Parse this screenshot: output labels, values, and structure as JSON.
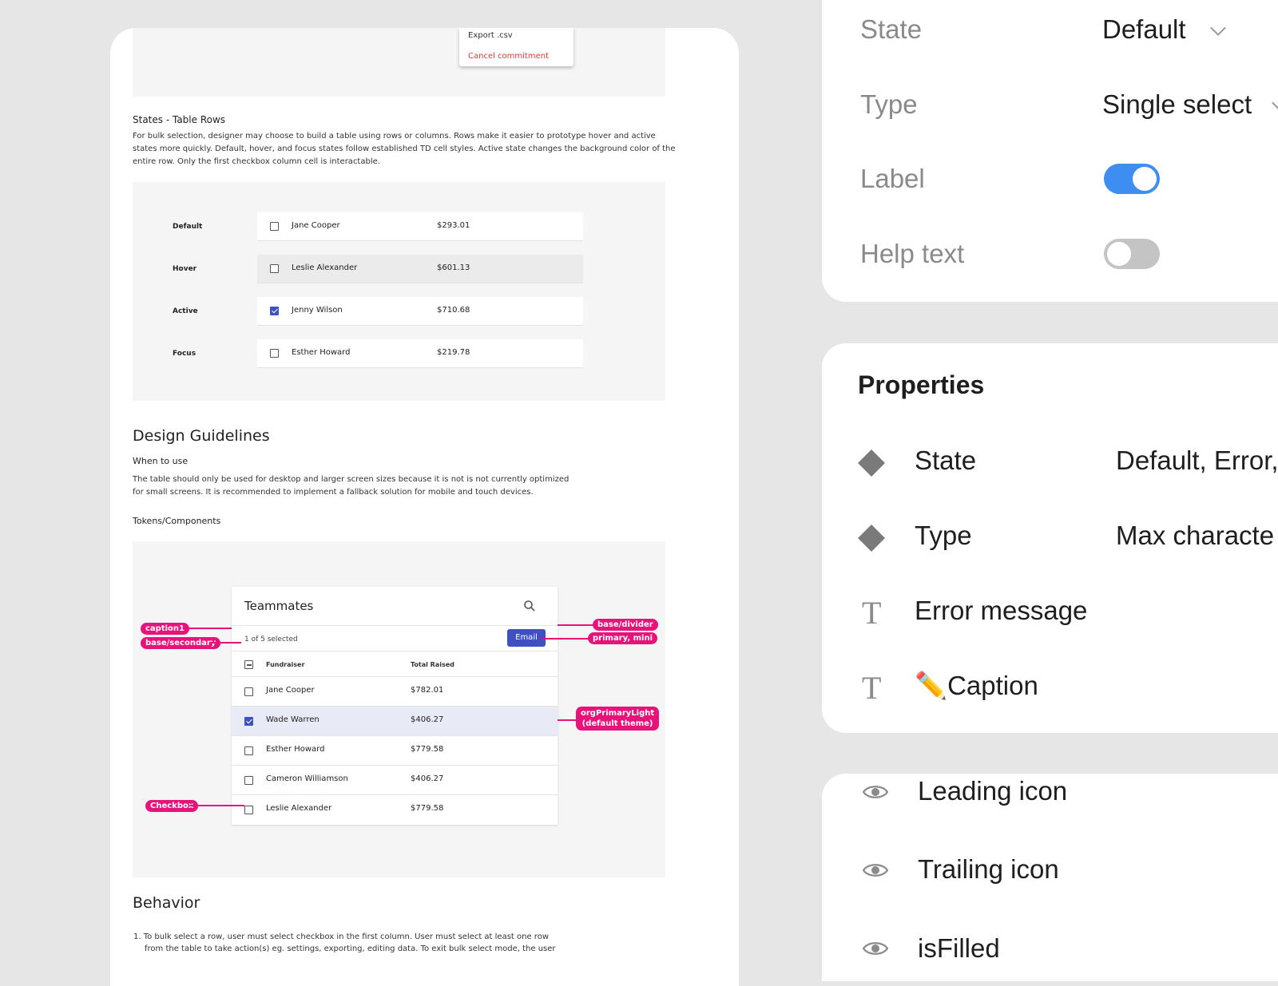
{
  "doc": {
    "menu": {
      "export": "Export .csv",
      "cancel": "Cancel commitment",
      "cancel_color": "#e53935"
    },
    "states_heading": "States - Table Rows",
    "states_desc_1": "For bulk selection, designer may choose to build a table using rows or columns. Rows make it easier to prototype hover and active",
    "states_desc_2": "states more quickly. Default, hover, and focus states follow established TD cell styles. Active state changes the background color of the",
    "states_desc_3": "entire row. Only the first checkbox column cell is interactable.",
    "state_rows": [
      {
        "state": "Default",
        "name": "Jane Cooper",
        "amount": "$293.01",
        "checked": false
      },
      {
        "state": "Hover",
        "name": "Leslie Alexander",
        "amount": "$601.13",
        "checked": false
      },
      {
        "state": "Active",
        "name": "Jenny Wilson",
        "amount": "$710.68",
        "checked": true
      },
      {
        "state": "Focus",
        "name": "Esther Howard",
        "amount": "$219.78",
        "checked": false
      }
    ],
    "guidelines_heading": "Design Guidelines",
    "when_heading": "When to use",
    "when_desc_1": "The table should only be used for desktop and larger screen sizes because it is not is not currently optimized",
    "when_desc_2": "for small screens. It is recommended to implement a fallback solution for mobile and touch devices.",
    "tokens_heading": "Tokens/Components",
    "teammates": {
      "title": "Teammates",
      "selected": "1 of 5 selected",
      "email_button": "Email",
      "col_fundraiser": "Fundraiser",
      "col_total": "Total Raised",
      "rows": [
        {
          "name": "Jane Cooper",
          "amount": "$782.01",
          "checked": false
        },
        {
          "name": "Wade Warren",
          "amount": "$406.27",
          "checked": true
        },
        {
          "name": "Esther Howard",
          "amount": "$779.58",
          "checked": false
        },
        {
          "name": "Cameron Williamson",
          "amount": "$406.27",
          "checked": false
        },
        {
          "name": "Leslie Alexander",
          "amount": "$779.58",
          "checked": false
        }
      ]
    },
    "annotations": {
      "caption1": "caption1",
      "base_secondary": "base/secondary",
      "base_divider": "base/divider",
      "primary_mini": "primary, mini",
      "org_primary_1": "orgPrimaryLight",
      "org_primary_2": "(default theme)",
      "checkbox": "Checkbox"
    },
    "behavior_heading": "Behavior",
    "behavior_1": "1. To bulk select a row, user must select checkbox in the first column. User must select at least one row",
    "behavior_2": "from the table to take action(s) eg. settings, exporting, editing data.  To exit bulk select mode, the user"
  },
  "panel1": {
    "state_label": "State",
    "state_value": "Default",
    "type_label": "Type",
    "type_value": "Single select",
    "label_label": "Label",
    "label_on": true,
    "help_label": "Help text",
    "help_on": false
  },
  "panel2": {
    "title": "Properties",
    "rows": [
      {
        "icon": "diamond-icon",
        "name": "State",
        "value": "Default, Error,"
      },
      {
        "icon": "diamond-icon",
        "name": "Type",
        "value": "Max characte"
      },
      {
        "icon": "text-icon",
        "name": "Error message",
        "value": ""
      },
      {
        "icon": "text-icon",
        "name": "✏️Caption",
        "value": ""
      }
    ]
  },
  "panel3": {
    "rows": [
      {
        "icon": "eye-icon",
        "name": "Leading icon"
      },
      {
        "icon": "eye-icon",
        "name": "Trailing icon"
      },
      {
        "icon": "eye-icon",
        "name": "isFilled"
      }
    ]
  },
  "colors": {
    "accent": "#3f51c2",
    "annotation": "#e8137a",
    "toggle_on": "#3d8ef0"
  }
}
